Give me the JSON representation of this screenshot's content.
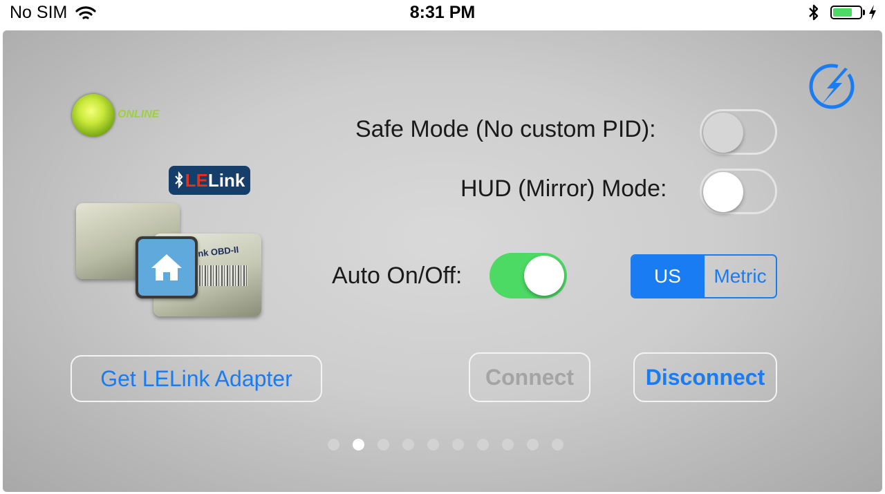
{
  "status_bar": {
    "carrier": "No SIM",
    "time": "8:31 PM",
    "battery_level": 0.7,
    "wifi_icon": "wifi-icon",
    "bluetooth_icon": "bluetooth-icon",
    "charging_icon": "charging-bolt-icon"
  },
  "device": {
    "status_text": "ONLINE",
    "brand_badge_prefix": "LE",
    "brand_badge_suffix": "Link",
    "adapter_label": "LELink OBD-II"
  },
  "settings": {
    "safe_mode_label": "Safe Mode (No custom PID):",
    "safe_mode_on": false,
    "hud_mode_label": "HUD (Mirror) Mode:",
    "hud_mode_on": false,
    "auto_on_off_label": "Auto On/Off:",
    "auto_on_off_on": true
  },
  "units": {
    "options": [
      "US",
      "Metric"
    ],
    "selected": "US"
  },
  "buttons": {
    "get_adapter": "Get LELink Adapter",
    "connect": "Connect",
    "disconnect": "Disconnect"
  },
  "pager": {
    "page_count": 10,
    "current_page": 2
  },
  "colors": {
    "accent": "#1a7cf2",
    "switch_on": "#4cd964",
    "status_led": "#c9e83a"
  }
}
